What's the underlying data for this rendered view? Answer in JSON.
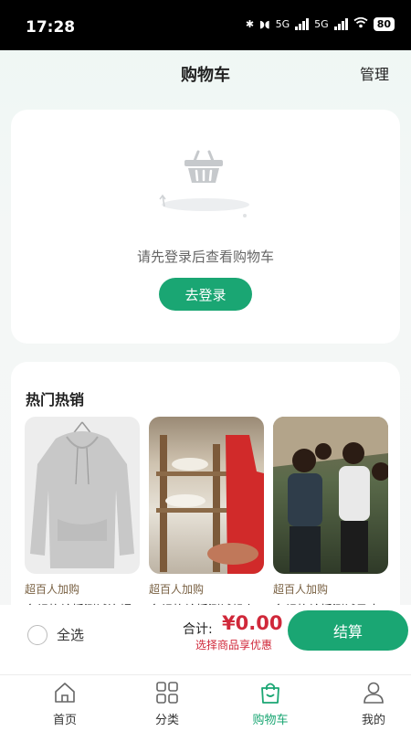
{
  "status_bar": {
    "time": "17:28",
    "signal1": "5G",
    "signal2": "5G",
    "battery": "80"
  },
  "header": {
    "title": "购物车",
    "manage_label": "管理"
  },
  "empty_cart": {
    "message": "请先登录后查看购物车",
    "login_label": "去登录"
  },
  "hot_section": {
    "title": "热门热销",
    "products": [
      {
        "tag": "超百人加购",
        "name": "多规格轮播测试连帽",
        "image": "grey-hoodie"
      },
      {
        "tag": "超百人加购",
        "name": "多规格轮播测试帆布",
        "image": "market-shelves"
      },
      {
        "tag": "超百人加购",
        "name": "多规格轮播测试马克",
        "image": "group-of-children"
      }
    ]
  },
  "checkout_bar": {
    "select_all_label": "全选",
    "total_label": "合计:",
    "total_amount": "¥0.00",
    "discount_hint": "选择商品享优惠",
    "checkout_label": "结算"
  },
  "tabs": [
    {
      "label": "首页",
      "icon": "home-icon"
    },
    {
      "label": "分类",
      "icon": "grid-icon"
    },
    {
      "label": "购物车",
      "icon": "shopping-bag-icon"
    },
    {
      "label": "我的",
      "icon": "user-icon"
    }
  ],
  "colors": {
    "accent": "#1aa673",
    "price": "#d0283a",
    "tag": "#7a6244"
  }
}
